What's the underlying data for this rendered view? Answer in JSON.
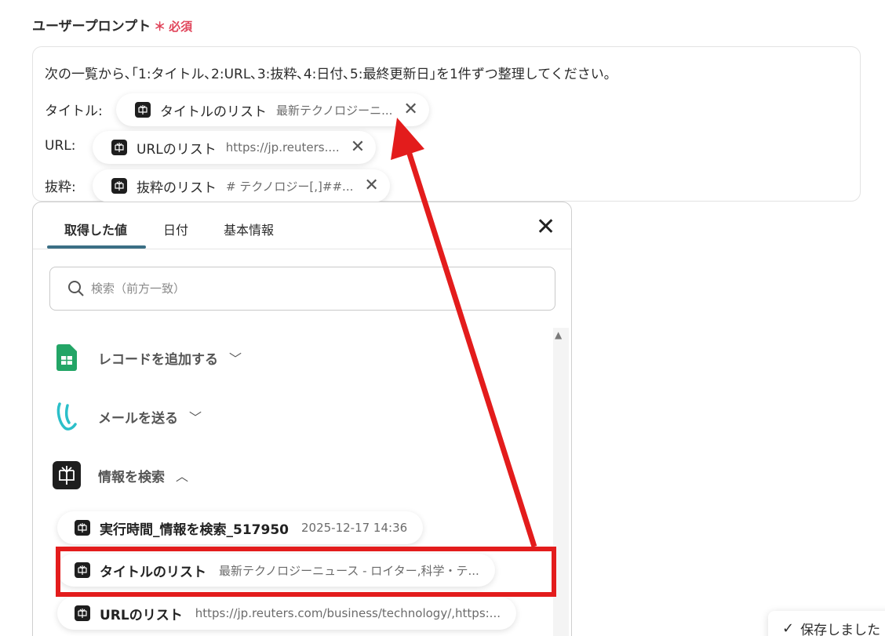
{
  "field": {
    "label": "ユーザープロンプト",
    "required_mark": "＊",
    "required_text": "必須"
  },
  "prompt": {
    "text": "次の一覧から､｢1:タイトル､2:URL､3:抜粋､4:日付､5:最終更新日｣を1件ずつ整理してください｡",
    "rows": [
      {
        "label": "タイトル:",
        "chip_name": "タイトルのリスト",
        "chip_value": "最新テクノロジーニ..."
      },
      {
        "label": "URL:",
        "chip_name": "URLのリスト",
        "chip_value": "https://jp.reuters...."
      },
      {
        "label": "抜粋:",
        "chip_name": "抜粋のリスト",
        "chip_value": "# テクノロジー[,]##..."
      }
    ]
  },
  "dropdown": {
    "tabs": [
      "取得した値",
      "日付",
      "基本情報"
    ],
    "search_placeholder": "検索（前方一致）",
    "groups": [
      {
        "label": "レコードを追加する",
        "icon": "sheets-icon"
      },
      {
        "label": "メールを送る",
        "icon": "mail-app-icon"
      },
      {
        "label": "情報を検索",
        "icon": "perplexity-icon"
      }
    ],
    "items": [
      {
        "name": "実行時間_情報を検索_517950",
        "value": "2025-12-17 14:36"
      },
      {
        "name": "タイトルのリスト",
        "value": "最新テクノロジーニュース - ロイター,科学・テ..."
      },
      {
        "name": "URLのリスト",
        "value": "https://jp.reuters.com/business/technology/,https:..."
      }
    ]
  },
  "toast": {
    "text": "保存しました"
  },
  "colors": {
    "required": "#e0445a",
    "tab_underline": "#3b6f85",
    "highlight": "#e31c1c"
  }
}
